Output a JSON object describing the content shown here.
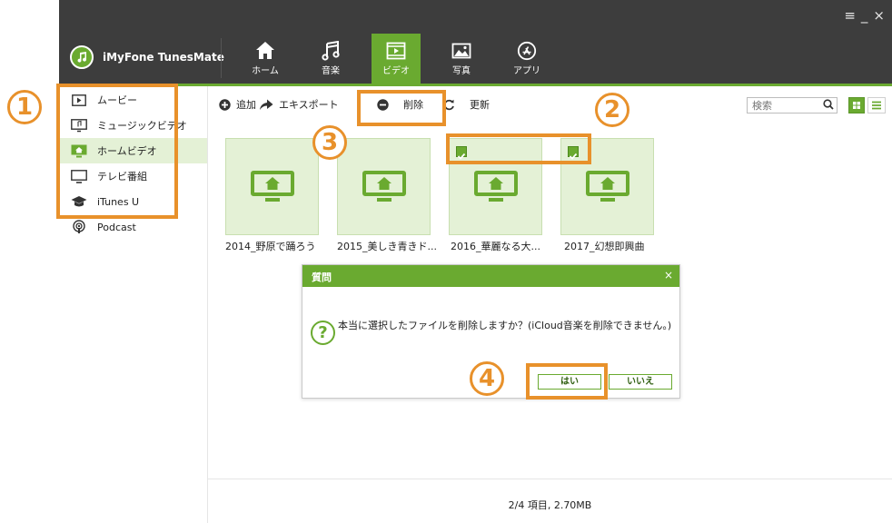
{
  "window": {
    "controls": [
      "≡",
      "_",
      "×"
    ],
    "app_title": "iMyFone TunesMate"
  },
  "nav": {
    "tabs": [
      {
        "label": "ホーム",
        "icon": "home-icon"
      },
      {
        "label": "音楽",
        "icon": "music-icon"
      },
      {
        "label": "ビデオ",
        "icon": "video-icon",
        "active": true
      },
      {
        "label": "写真",
        "icon": "photo-icon"
      },
      {
        "label": "アプリ",
        "icon": "app-store-icon"
      }
    ]
  },
  "sidebar": {
    "items": [
      {
        "label": "ムービー",
        "icon": "movie-icon"
      },
      {
        "label": "ミュージックビデオ",
        "icon": "music-video-icon"
      },
      {
        "label": "ホームビデオ",
        "icon": "home-video-icon",
        "active": true
      },
      {
        "label": "テレビ番組",
        "icon": "tv-icon"
      },
      {
        "label": "iTunes U",
        "icon": "graduation-cap-icon"
      },
      {
        "label": "Podcast",
        "icon": "podcast-icon"
      }
    ]
  },
  "toolbar": {
    "add_label": "追加",
    "export_label": "エキスポート",
    "delete_label": "削除",
    "refresh_label": "更新",
    "search_placeholder": "検索"
  },
  "videos": [
    {
      "title": "2014_野原で踊ろう",
      "checked": false
    },
    {
      "title": "2015_美しき青きド...",
      "checked": false
    },
    {
      "title": "2016_華麗なる大...",
      "checked": true
    },
    {
      "title": "2017_幻想即興曲",
      "checked": true
    }
  ],
  "dialog": {
    "title": "質問",
    "close": "×",
    "question_mark": "?",
    "message": "本当に選択したファイルを削除しますか？(iCloud音楽を削除できません。)",
    "yes_label": "はい",
    "no_label": "いいえ"
  },
  "status": {
    "text": "2/4 項目, 2.70MB"
  },
  "annotations": [
    "1",
    "2",
    "3",
    "4"
  ],
  "colors": {
    "accent_green": "#6aaa30",
    "annotation_orange": "#e8912b",
    "titlebar": "#3d3d3d"
  }
}
